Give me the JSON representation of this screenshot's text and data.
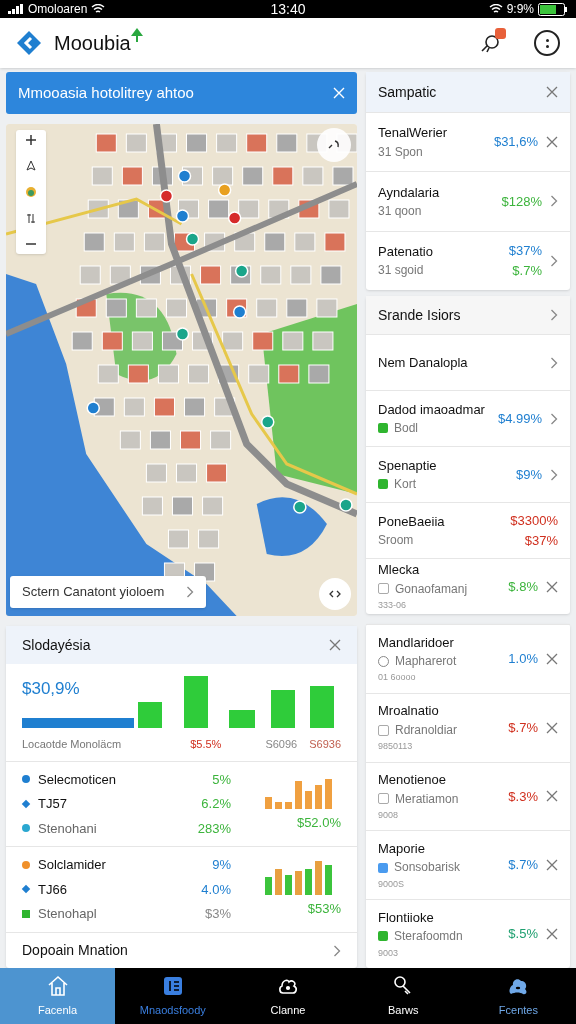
{
  "status_bar": {
    "carrier": "Omoloaren",
    "time": "13:40",
    "battery": "9:9%"
  },
  "header": {
    "title": "Mooubia",
    "notification": true
  },
  "banner": {
    "text": "Mmooasia hotolitrey ahtoo"
  },
  "map": {
    "search": "Sctern Canatont yioloem"
  },
  "summary_card": {
    "title": "Sampatic",
    "rows": [
      {
        "kind": "closable",
        "title": "TenalWerier",
        "subtitle": "31 Spon",
        "values": [
          {
            "text": "$31,6%",
            "color": "#1f7fd0"
          }
        ]
      },
      {
        "kind": "link",
        "title": "Ayndalaria",
        "subtitle": "31 qoon",
        "values": [
          {
            "text": "$128%",
            "color": "#3cb43c"
          }
        ]
      },
      {
        "kind": "link",
        "title": "Patenatio",
        "subtitle": "31 sgoid",
        "values": [
          {
            "text": "$37%",
            "color": "#1f7fd0"
          },
          {
            "text": "$.7%",
            "color": "#3cb43c"
          }
        ]
      }
    ]
  },
  "list_card": {
    "title": "Srande Isiors",
    "rows": [
      {
        "kind": "link",
        "title": "Nem Danalopla"
      },
      {
        "kind": "link",
        "title": "Dadod imaoadmar",
        "marker": {
          "kind": "square",
          "color": "#2fb52f"
        },
        "subtitle": "Bodl",
        "values": [
          {
            "text": "$4.99%",
            "color": "#1f7fd0"
          }
        ]
      },
      {
        "kind": "link",
        "title": "Spenaptie",
        "marker": {
          "kind": "square",
          "color": "#2fb52f"
        },
        "subtitle": "Kort",
        "values": [
          {
            "text": "$9%",
            "color": "#1f7fd0"
          }
        ]
      },
      {
        "kind": "plain",
        "title": "PoneBaeiia",
        "subtitle": "Sroom",
        "values": [
          {
            "text": "$3300%",
            "color": "#d0301f"
          },
          {
            "text": "$37%",
            "color": "#d0301f"
          }
        ]
      },
      {
        "kind": "closable",
        "title": "Mlecka",
        "marker": {
          "kind": "checkbox",
          "checked": false
        },
        "subtitle": "Gonaofamanj",
        "note": "333-06",
        "values": [
          {
            "text": "$.8%",
            "color": "#3cb43c"
          }
        ]
      }
    ]
  },
  "stats_card": {
    "title": "Slodayésia",
    "headline": "$30,9%",
    "chart_labels": [
      {
        "text": "Locaotde Monoläcm",
        "color": "#777777"
      },
      {
        "text": "$5.5%",
        "color": "#d0301f"
      },
      {
        "text": "S6096",
        "color": "#888888"
      },
      {
        "text": "S6936",
        "color": "#c06050"
      }
    ],
    "sections": [
      {
        "items": [
          {
            "kind": "dot",
            "color": "#1f7fd0",
            "text": "Selecmoticen"
          },
          {
            "kind": "diamond",
            "color": "#1f7fd0",
            "text": "TJ57"
          },
          {
            "kind": "dot",
            "color": "#2aa7d0",
            "text": "Stenohani"
          }
        ],
        "values": [
          {
            "text": "5%",
            "color": "#3cb43c"
          },
          {
            "text": "6.2%",
            "color": "#3cb43c"
          },
          {
            "text": "283%",
            "color": "#3cb43c"
          }
        ],
        "caption": {
          "text": "$52.0%",
          "color": "#3cb43c"
        }
      },
      {
        "items": [
          {
            "kind": "dot",
            "color": "#f0902a",
            "text": "Solclamider"
          },
          {
            "kind": "diamond",
            "color": "#1f7fd0",
            "text": "TJ66"
          },
          {
            "kind": "square",
            "color": "#2fb52f",
            "text": "Stenohapl"
          }
        ],
        "values": [
          {
            "text": "9%",
            "color": "#1f7fd0"
          },
          {
            "text": "4.0%",
            "color": "#1f7fd0"
          },
          {
            "text": "$3%",
            "color": "#888888"
          }
        ],
        "caption": {
          "text": "$53%",
          "color": "#3cb43c"
        }
      }
    ],
    "footer": "Dopoain Mnation"
  },
  "detail_card": {
    "rows": [
      {
        "kind": "closable",
        "title": "Mandlaridoer",
        "marker": {
          "kind": "radio",
          "checked": false
        },
        "subtitle": "Mapharerot",
        "note": "01 6oooo",
        "values": [
          {
            "text": "1.0%",
            "color": "#1f7fd0"
          }
        ]
      },
      {
        "kind": "closable",
        "title": "Mroalnatio",
        "marker": {
          "kind": "checkbox",
          "checked": false
        },
        "subtitle": "Rdranoldiar",
        "note": "9850113",
        "values": [
          {
            "text": "$.7%",
            "color": "#d0301f"
          }
        ]
      },
      {
        "kind": "closable",
        "title": "Menotienoe",
        "marker": {
          "kind": "checkbox",
          "checked": false
        },
        "subtitle": "Meratiamon",
        "note": "9008",
        "values": [
          {
            "text": "$.3%",
            "color": "#d0301f"
          }
        ]
      },
      {
        "kind": "closable",
        "title": "Maporie",
        "marker": {
          "kind": "square",
          "color": "#4a9bef"
        },
        "subtitle": "Sonsobarisk",
        "note": "9000S",
        "values": [
          {
            "text": "$.7%",
            "color": "#1f7fd0"
          }
        ]
      },
      {
        "kind": "closable",
        "title": "Flontiioke",
        "marker": {
          "kind": "square",
          "color": "#2fb52f"
        },
        "subtitle": "Sterafoomdn",
        "note": "9003",
        "values": [
          {
            "text": "$.5%",
            "color": "#1fa070"
          }
        ]
      }
    ]
  },
  "tab_bar": [
    {
      "label": "Facenla",
      "selected": true,
      "color": "#ffffff"
    },
    {
      "label": "Mnaodsfoody",
      "selected": false,
      "color": "#3a7fe0"
    },
    {
      "label": "Clanne",
      "selected": false,
      "color": "#ffffff"
    },
    {
      "label": "Barws",
      "selected": false,
      "color": "#ffffff"
    },
    {
      "label": "Fcentes",
      "selected": false,
      "color": "#6fa8e8"
    }
  ]
}
